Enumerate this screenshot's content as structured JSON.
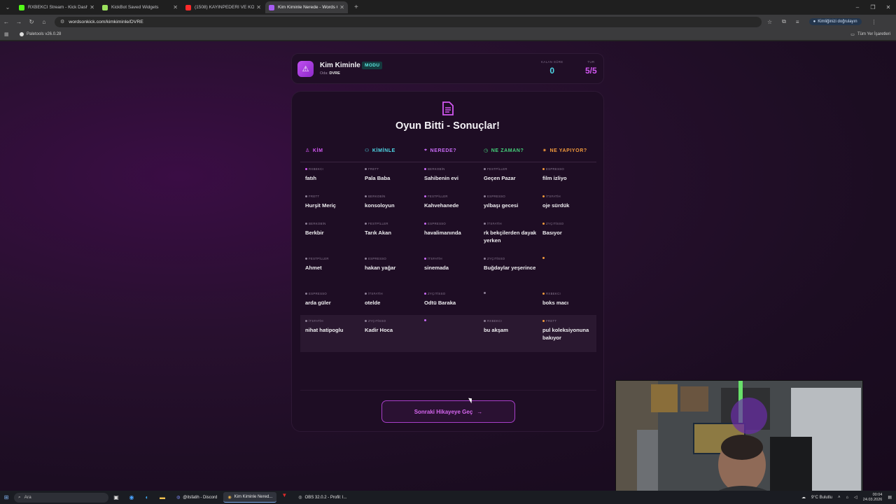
{
  "browser": {
    "tabs": [
      {
        "title": "RXBEKCI Stream - Kick Dash",
        "color": "#53fc18",
        "active": false
      },
      {
        "title": "KickBot Saved Widgets",
        "color": "#9be15d",
        "active": false
      },
      {
        "title": "(1508) KAYINPEDERİ VE KOCASI",
        "color": "#ff2a2a",
        "active": false
      },
      {
        "title": "Kim Kiminle Nerede - Words O",
        "color": "#a55bf0",
        "active": true
      }
    ],
    "url": "wordsonkick.com/kimkiminle/DVRE",
    "auth_label": "Kimliğinizi doğrulayın",
    "bookmark": "Paletools v26.0.28",
    "all_bookmarks": "Tüm Yer İşaretleri"
  },
  "game": {
    "title": "Kim Kiminle",
    "mode_badge": "MODU",
    "room_label": "Oda:",
    "room_code": "DVRE",
    "remaining_label": "KALAN SÜRE",
    "remaining_value": "0",
    "round_label": "TUR",
    "round_value": "5/5",
    "results_title": "Oyun Bitti - Sonuçlar!",
    "columns": [
      {
        "label": "KİM",
        "color": "#d257f2"
      },
      {
        "label": "KİMİNLE",
        "color": "#4fd9e8"
      },
      {
        "label": "NEREDE?",
        "color": "#c86af5"
      },
      {
        "label": "NE ZAMAN?",
        "color": "#44d17a"
      },
      {
        "label": "NE YAPIYOR?",
        "color": "#f29a3c"
      }
    ],
    "rows": [
      [
        {
          "user": "RXBEKCI",
          "dot": "#d257f2",
          "answer": "fatıh"
        },
        {
          "user": "FRETT",
          "dot": "#8d7f96",
          "answer": "Pala Baba"
        },
        {
          "user": "BERKOBİN",
          "dot": "#c86af5",
          "answer": "Sahibenin evi"
        },
        {
          "user": "FESTPİLLER",
          "dot": "#8d7f96",
          "answer": "Geçen Pazar"
        },
        {
          "user": "ESPRESSO",
          "dot": "#f29a3c",
          "answer": "film izliyo"
        }
      ],
      [
        {
          "user": "FRETT",
          "dot": "#8d7f96",
          "answer": "Hurşit Meriç"
        },
        {
          "user": "BERKOBİN",
          "dot": "#8d7f96",
          "answer": "konsoloyun"
        },
        {
          "user": "FESTPİLLER",
          "dot": "#c86af5",
          "answer": "Kahvehanede"
        },
        {
          "user": "ESPRESSO",
          "dot": "#8d7f96",
          "answer": "yılbaşı gecesi"
        },
        {
          "user": "İTSFATİH",
          "dot": "#f29a3c",
          "answer": "oje sürdük"
        }
      ],
      [
        {
          "user": "BERKOBİN",
          "dot": "#8d7f96",
          "answer": "Berkbir"
        },
        {
          "user": "FESTPİLLER",
          "dot": "#8d7f96",
          "answer": "Tarık Akan"
        },
        {
          "user": "ESPRESSO",
          "dot": "#c86af5",
          "answer": "havalimanında"
        },
        {
          "user": "İTSFATİH",
          "dot": "#8d7f96",
          "answer": "rk bekçilerden dayak yerken"
        },
        {
          "user": "ZYÇITİSSO",
          "dot": "#f29a3c",
          "answer": "Basıyor"
        }
      ],
      [
        {
          "user": "FESTPİLLER",
          "dot": "#8d7f96",
          "answer": "Ahmet"
        },
        {
          "user": "ESPRESSO",
          "dot": "#8d7f96",
          "answer": "hakan yağar"
        },
        {
          "user": "İTSFATİH",
          "dot": "#c86af5",
          "answer": "sinemada"
        },
        {
          "user": "ZYÇITİSSO",
          "dot": "#8d7f96",
          "answer": "Buğdaylar yeşerince"
        },
        {
          "user": "",
          "dot": "#f29a3c",
          "answer": ""
        }
      ],
      [
        {
          "user": "ESPRESSO",
          "dot": "#8d7f96",
          "answer": "arda güler"
        },
        {
          "user": "İTSFATİH",
          "dot": "#8d7f96",
          "answer": "otelde"
        },
        {
          "user": "ZYÇITİSSO",
          "dot": "#c86af5",
          "answer": "Odtü Baraka"
        },
        {
          "user": "",
          "dot": "#8d7f96",
          "answer": ""
        },
        {
          "user": "RXBEKCI",
          "dot": "#f29a3c",
          "answer": "boks macı"
        }
      ],
      [
        {
          "user": "İTSFATİH",
          "dot": "#8d7f96",
          "answer": "nihat hatipoglu"
        },
        {
          "user": "ZYÇITİSSO",
          "dot": "#8d7f96",
          "answer": "Kadir Hoca"
        },
        {
          "user": "",
          "dot": "#c86af5",
          "answer": ""
        },
        {
          "user": "RXBEKCI",
          "dot": "#8d7f96",
          "answer": "bu akşam"
        },
        {
          "user": "FRETT",
          "dot": "#f29a3c",
          "answer": "pul koleksiyonuna bakıyor"
        }
      ]
    ],
    "next_button": "Sonraki Hikayeye Geç"
  },
  "taskbar": {
    "search_placeholder": "Ara",
    "apps": [
      {
        "label": "@itsfatih - Discord",
        "active": false
      },
      {
        "label": "Kim Kiminle Nered...",
        "active": true
      },
      {
        "label": "OBS 32.0.2 - Profil: I...",
        "active": false
      }
    ],
    "weather": "9°C Bulutlu",
    "time": "00:04",
    "date": "24.03.2026"
  }
}
